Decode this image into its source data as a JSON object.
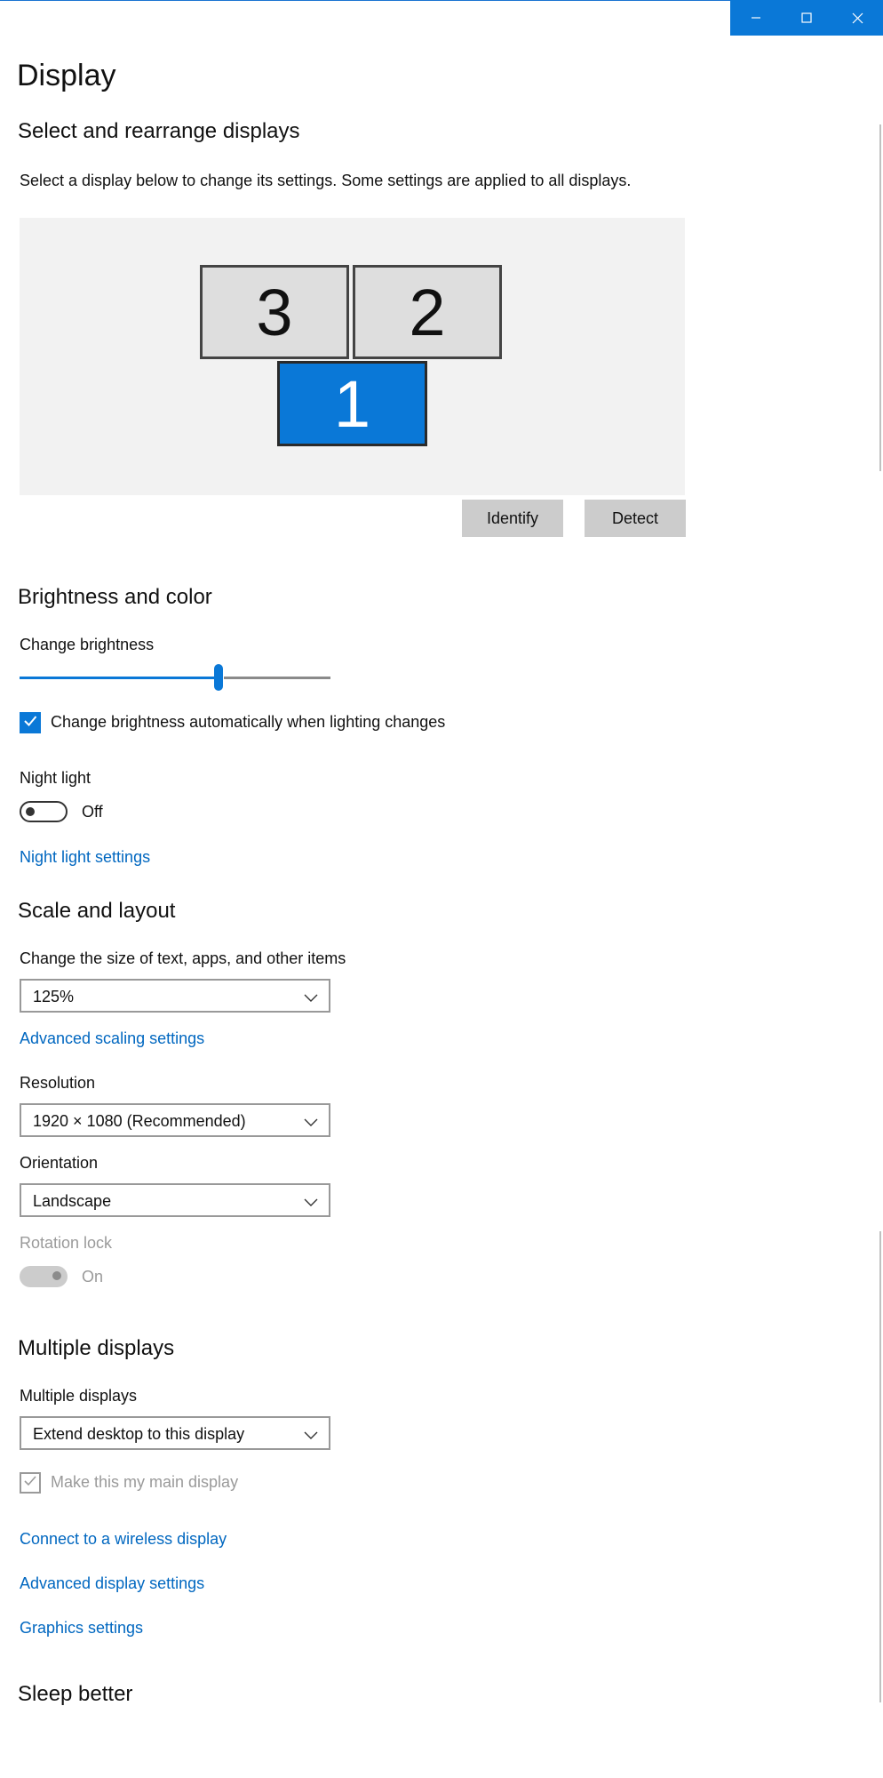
{
  "window": {
    "minimize_icon": "minimize-icon",
    "maximize_icon": "maximize-icon",
    "close_icon": "close-icon",
    "accent_color": "#0a78d7"
  },
  "page_title": "Display",
  "arrange": {
    "heading": "Select and rearrange displays",
    "description": "Select a display below to change its settings. Some settings are applied to all displays.",
    "monitors": [
      {
        "label": "3",
        "selected": false
      },
      {
        "label": "2",
        "selected": false
      },
      {
        "label": "1",
        "selected": true
      }
    ],
    "identify_label": "Identify",
    "detect_label": "Detect"
  },
  "brightness": {
    "heading": "Brightness and color",
    "change_brightness_label": "Change brightness",
    "brightness_value_percent": 64,
    "auto_brightness_label": "Change brightness automatically when lighting changes",
    "auto_brightness_checked": true,
    "night_light_label": "Night light",
    "night_light_state": "Off",
    "night_light_settings_link": "Night light settings"
  },
  "scale": {
    "heading": "Scale and layout",
    "size_label": "Change the size of text, apps, and other items",
    "size_value": "125%",
    "advanced_scaling_link": "Advanced scaling settings",
    "resolution_label": "Resolution",
    "resolution_value": "1920 × 1080 (Recommended)",
    "orientation_label": "Orientation",
    "orientation_value": "Landscape",
    "rotation_lock_label": "Rotation lock",
    "rotation_lock_state": "On"
  },
  "multiple": {
    "heading": "Multiple displays",
    "label": "Multiple displays",
    "value": "Extend desktop to this display",
    "main_display_label": "Make this my main display",
    "main_display_checked": true,
    "wireless_link": "Connect to a wireless display",
    "advanced_display_link": "Advanced display settings",
    "graphics_link": "Graphics settings"
  },
  "sleep": {
    "heading": "Sleep better"
  }
}
